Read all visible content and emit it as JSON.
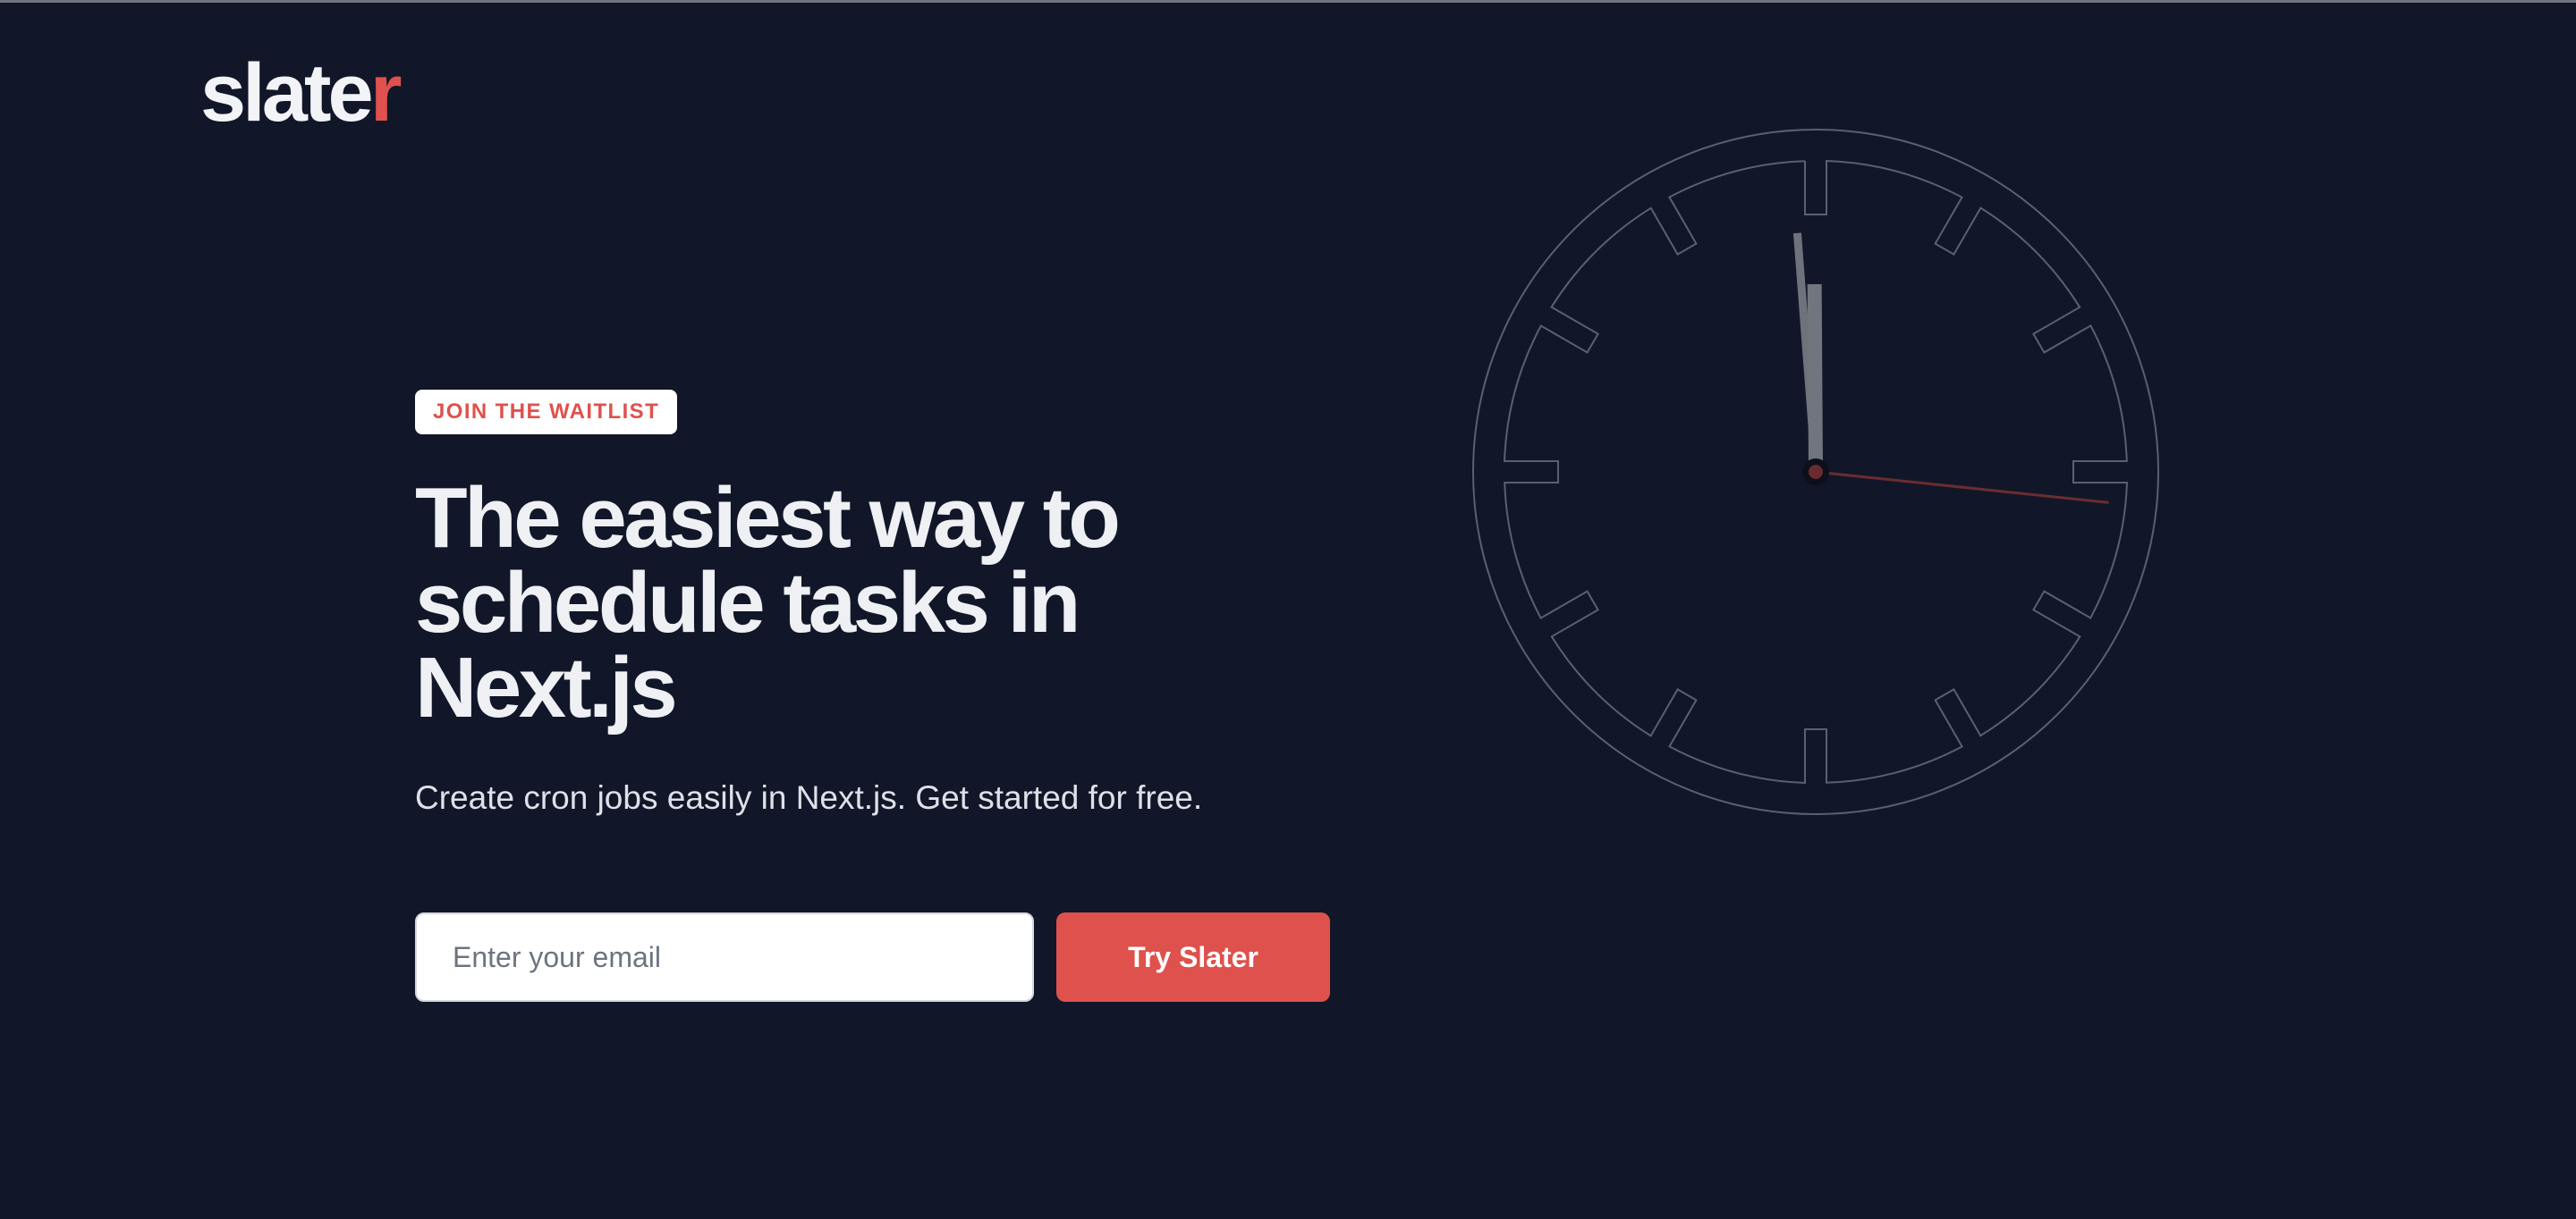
{
  "brand": {
    "logo_main": "slate",
    "logo_accent": "r",
    "accent_color": "#df514d",
    "background_color": "#111729"
  },
  "hero": {
    "badge": "JOIN THE WAITLIST",
    "headline": "The easiest way to schedule tasks in Next.js",
    "subheadline": "Create cron jobs easily in Next.js. Get started for free."
  },
  "signup": {
    "email_placeholder": "Enter your email",
    "email_value": "",
    "button_label": "Try Slater"
  },
  "clock": {
    "icon": "clock-illustration",
    "hour": 11,
    "minute": 59,
    "second": 16
  }
}
